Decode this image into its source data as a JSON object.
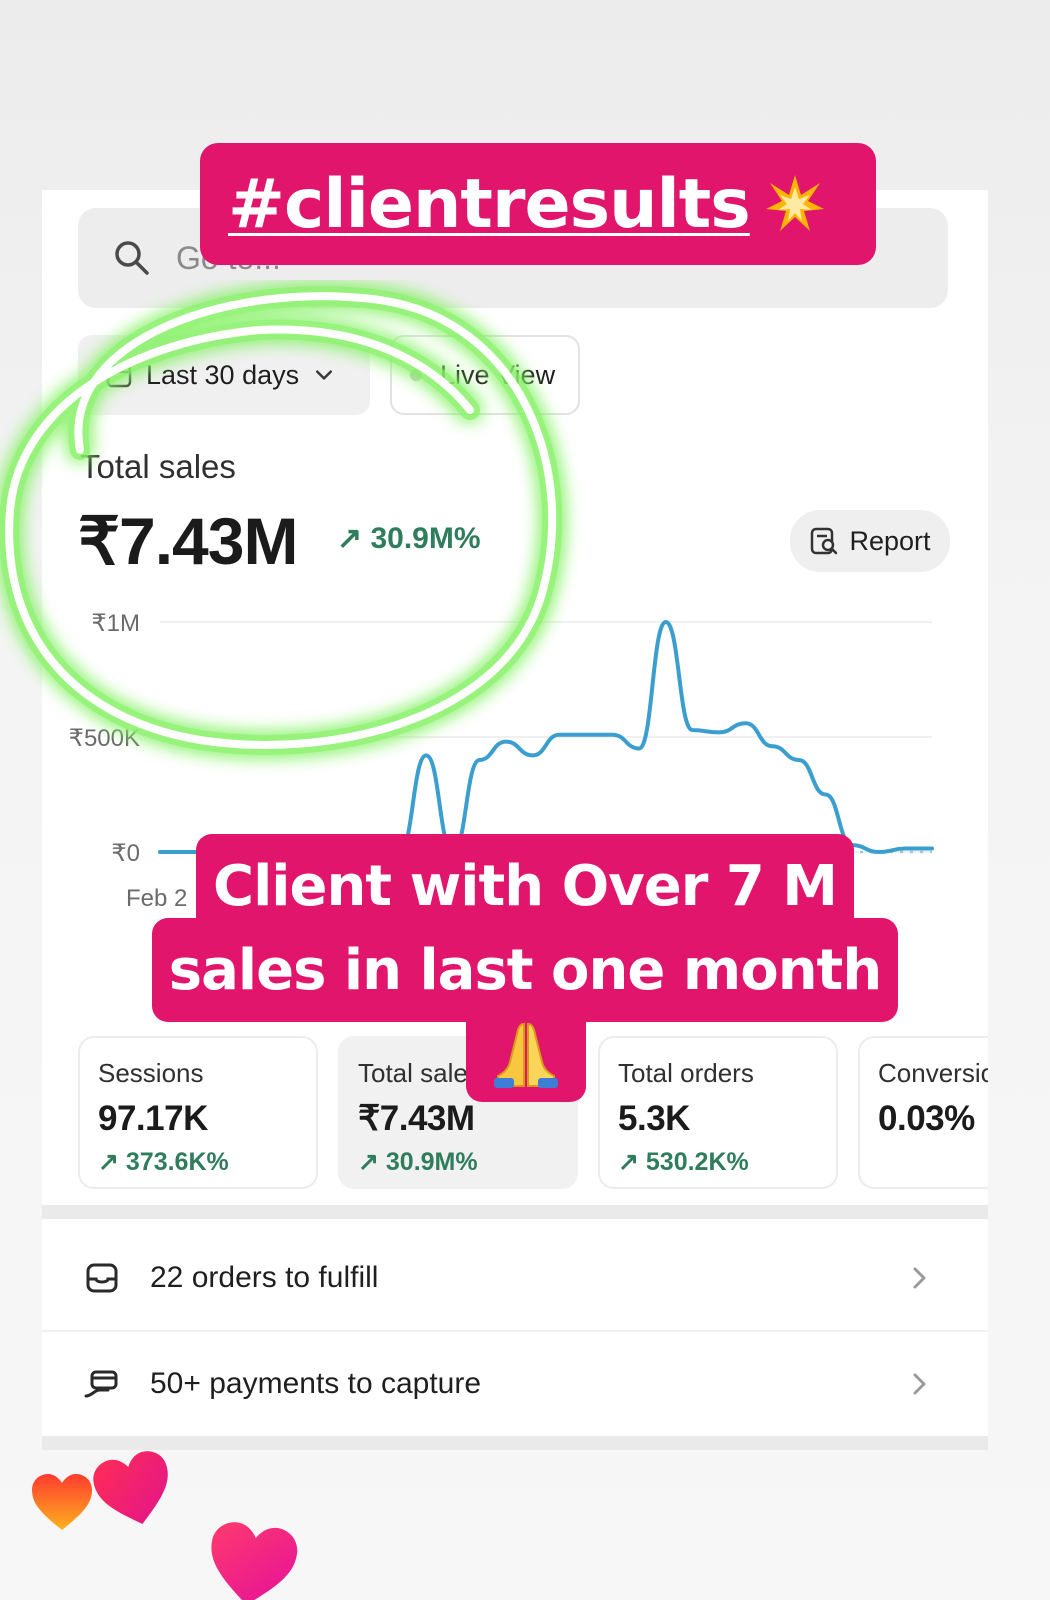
{
  "search": {
    "placeholder": "Go to..."
  },
  "filters": {
    "date_range": "Last 30 days",
    "live_view": "Live View"
  },
  "summary": {
    "label": "Total sales",
    "value": "₹7.43M",
    "delta": "↗ 30.9M%",
    "report_label": "Report"
  },
  "chart_data": {
    "type": "line",
    "title": "",
    "xlabel": "",
    "ylabel": "",
    "y_tick_labels": [
      "₹1M",
      "₹500K",
      "₹0"
    ],
    "x_tick_labels": [
      "Feb 2"
    ],
    "ylim": [
      0,
      1000000
    ],
    "grid": true,
    "series": [
      {
        "values": [
          0,
          0,
          0,
          0,
          0,
          0,
          0,
          0,
          0,
          0,
          420000,
          0,
          400000,
          480000,
          420000,
          510000,
          510000,
          510000,
          450000,
          1000000,
          530000,
          520000,
          560000,
          460000,
          400000,
          250000,
          30000,
          0,
          15000,
          15000
        ]
      }
    ],
    "comparison_series_style": "dotted"
  },
  "stats": [
    {
      "label": "Sessions",
      "value": "97.17K",
      "delta": "↗ 373.6K%"
    },
    {
      "label": "Total sales",
      "value": "₹7.43M",
      "delta": "↗ 30.9M%"
    },
    {
      "label": "Total orders",
      "value": "5.3K",
      "delta": "↗ 530.2K%"
    },
    {
      "label": "Conversion rate",
      "value": "0.03%",
      "delta": ""
    }
  ],
  "tasks": [
    {
      "label": "22 orders to fulfill"
    },
    {
      "label": "50+ payments to capture"
    }
  ],
  "overlay": {
    "hashtag": "#clientresults",
    "caption_line1": "Client with Over 7 M",
    "caption_line2": "sales in last one month"
  },
  "colors": {
    "sticker": "#e0156b",
    "positive": "#2f7d5c",
    "line": "#3a9fcf",
    "highlight_ring": "#7cf05a"
  },
  "icons": [
    "search-icon",
    "calendar-icon",
    "chevron-down-icon",
    "report-icon",
    "inbox-icon",
    "payment-icon",
    "chevron-right-icon",
    "burst-emoji",
    "pray-emoji",
    "heart-sticker"
  ]
}
